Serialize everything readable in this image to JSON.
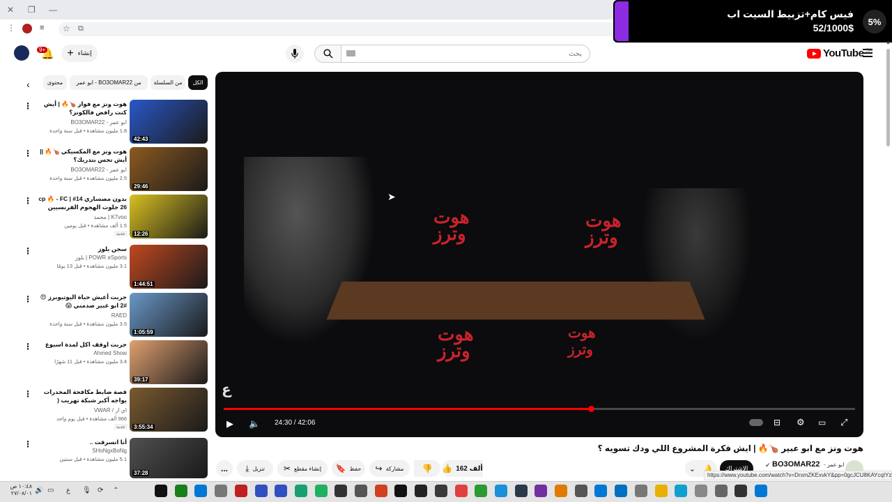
{
  "promo": {
    "title": "فيس كام+تزبيط السيت اب",
    "subtitle": "52/1000$",
    "badge": "5%"
  },
  "header": {
    "logo": "YouTube",
    "country": "SA",
    "search_placeholder": "بحث",
    "create_label": "إنشاء",
    "notifications_badge": "9+"
  },
  "chips": [
    "الكل",
    "من السلسلة",
    "من BO3OMAR22 - ابو عمر",
    "محتوى"
  ],
  "player": {
    "time_current": "24:30",
    "time_total": "42:06",
    "time_display": "24:30 / 42:06",
    "progress": 0.582,
    "sign_text": "هوت وترز"
  },
  "video": {
    "title": "هوت ونز مع ابو عبير 🍗🔥 | ايش فكرة المشروع اللي ودك تسويه ؟",
    "channel_name": "BO3OMAR22",
    "channel_handle": "ابو عمر -",
    "subscribe_label": "الاشتراك",
    "actions": {
      "likes": "162 ألف",
      "share": "مشاركة",
      "save": "حفظ",
      "clip": "إنشاء مقطع",
      "download": "تنزيل",
      "more": "..."
    }
  },
  "status_url": "https://www.youtube.com/watch?v=DrxmZKExvkY&pp=0gcJCU8KAYcqIYzv",
  "recommendations": [
    {
      "title": "هوت ونز مع فواز 🍗🔥 | أيش كنت رافض فالكونز؟",
      "channel": "ابو عمر - BO3OMAR22",
      "meta": "1.8 مليون مشاهدة • قبل سنة واحدة",
      "duration": "42:43",
      "thumb_color": "#2a58c8",
      "badge": ""
    },
    {
      "title": "هوت ونز مع المكسيكي 🍗🔥 || أيش تحس بتدريك؟",
      "channel": "ابو عمر - BO3OMAR22",
      "meta": "2.5 مليون مشاهدة • قبل سنة واحدة",
      "duration": "29:46",
      "thumb_color": "#8c5a20",
      "badge": ""
    },
    {
      "title": "بدون مصساري 14# | cp 🔥 - FC 26 جلوت الهجوم الفرنسيين",
      "channel": "K7voo | محمد",
      "meta": "1.5 ألف مشاهدة • قبل يومين",
      "duration": "12:26",
      "thumb_color": "#d8c020",
      "badge": "جديد"
    },
    {
      "title": "سجن بلوز",
      "channel": "POWR eSports | بلوز",
      "meta": "3.1 مليون مشاهدة • قبل 13 يومًا",
      "duration": "1:44:51",
      "thumb_color": "#c04820",
      "badge": ""
    },
    {
      "title": "جربت أعيش حياة اليوتيوبرز 😍 #2 ابو عبير صدمني 😱",
      "channel": "RAED",
      "meta": "3.5 مليون مشاهدة • قبل سنة واحدة",
      "duration": "1:05:59",
      "thumb_color": "#6a98c8",
      "badge": ""
    },
    {
      "title": "جربت اوقف اكل لمدة اسبوع",
      "channel": "Ahmed Show",
      "meta": "3.4 مليون مشاهدة • قبل 11 شهرًا",
      "duration": "39:17",
      "thumb_color": "#e0a070",
      "badge": ""
    },
    {
      "title": "قصة ضابط مكافحة المخدرات يواجه أكبر شبكة تهريب ( المهرب الطاغية ) !",
      "channel": "اي ار / VWAR",
      "meta": "966 ألف مشاهدة • قبل يوم واحد",
      "duration": "3:55:34",
      "thumb_color": "#7a5a30",
      "badge": "جديد"
    },
    {
      "title": "أنا اتسرقت ..",
      "channel": "SHoNgxBoNg",
      "meta": "5.1 مليون مشاهدة • قبل سنتين",
      "duration": "37:28",
      "thumb_color": "#505050",
      "badge": ""
    }
  ],
  "taskbar": {
    "time": "١٠:٤٨ ص",
    "date": "٢٧/٠٨/٠١"
  }
}
